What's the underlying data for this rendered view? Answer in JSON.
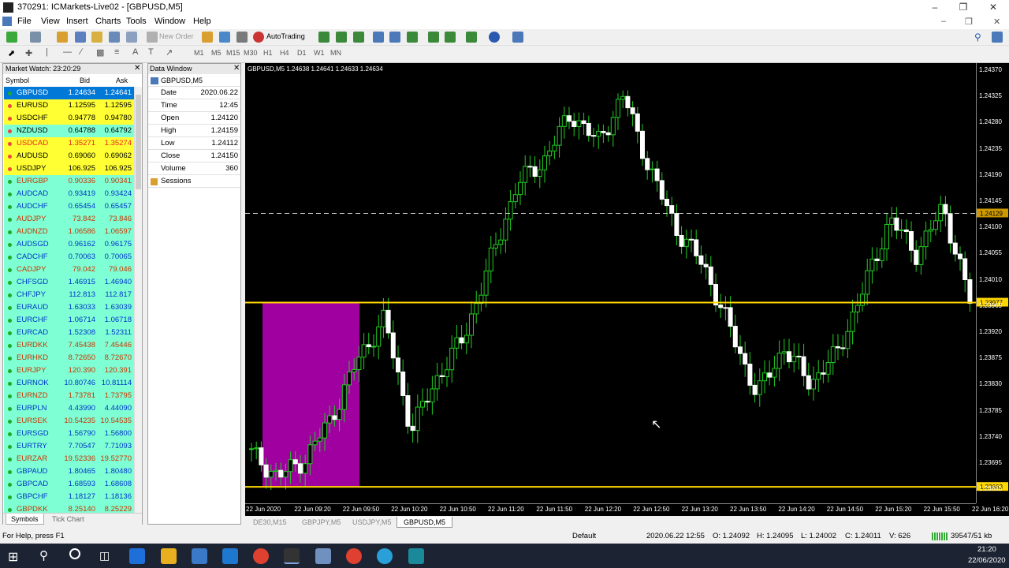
{
  "window": {
    "title": "370291: ICMarkets-Live02 - [GBPUSD,M5]"
  },
  "menu": [
    "File",
    "View",
    "Insert",
    "Charts",
    "Tools",
    "Window",
    "Help"
  ],
  "toolbar": {
    "new_order": "New Order",
    "autotrading": "AutoTrading",
    "timeframes": [
      "M1",
      "M5",
      "M15",
      "M30",
      "H1",
      "H4",
      "D1",
      "W1",
      "MN"
    ]
  },
  "market_watch": {
    "title": "Market Watch: 23:20:29",
    "col_symbol": "Symbol",
    "col_bid": "Bid",
    "col_ask": "Ask",
    "rows": [
      {
        "sym": "GBPUSD",
        "bid": "1.24634",
        "ask": "1.24641",
        "bg": "#0078d7",
        "fg": "#fff",
        "dot": "#22aa22"
      },
      {
        "sym": "EURUSD",
        "bid": "1.12595",
        "ask": "1.12595",
        "bg": "#ffff33",
        "fg": "#000",
        "dot": "#ee4444"
      },
      {
        "sym": "USDCHF",
        "bid": "0.94778",
        "ask": "0.94780",
        "bg": "#ffff33",
        "fg": "#000",
        "dot": "#ee4444"
      },
      {
        "sym": "NZDUSD",
        "bid": "0.64788",
        "ask": "0.64792",
        "bg": "#7fffd4",
        "fg": "#000",
        "dot": "#ee4444"
      },
      {
        "sym": "USDCAD",
        "bid": "1.35271",
        "ask": "1.35274",
        "bg": "#ffff33",
        "fg": "#ee2222",
        "dot": "#ee4444"
      },
      {
        "sym": "AUDUSD",
        "bid": "0.69060",
        "ask": "0.69062",
        "bg": "#ffff33",
        "fg": "#000",
        "dot": "#ee4444"
      },
      {
        "sym": "USDJPY",
        "bid": "106.925",
        "ask": "106.925",
        "bg": "#ffff33",
        "fg": "#000",
        "dot": "#ee4444"
      },
      {
        "sym": "EURGBP",
        "bid": "0.90336",
        "ask": "0.90341",
        "bg": "#7fffd4",
        "fg": "#cc3300",
        "dot": "#22aa22"
      },
      {
        "sym": "AUDCAD",
        "bid": "0.93419",
        "ask": "0.93424",
        "bg": "#7fffd4",
        "fg": "#0033cc",
        "dot": "#22aa22"
      },
      {
        "sym": "AUDCHF",
        "bid": "0.65454",
        "ask": "0.65457",
        "bg": "#7fffd4",
        "fg": "#0033cc",
        "dot": "#22aa22"
      },
      {
        "sym": "AUDJPY",
        "bid": "73.842",
        "ask": "73.846",
        "bg": "#7fffd4",
        "fg": "#cc3300",
        "dot": "#22aa22"
      },
      {
        "sym": "AUDNZD",
        "bid": "1.06586",
        "ask": "1.06597",
        "bg": "#7fffd4",
        "fg": "#cc3300",
        "dot": "#22aa22"
      },
      {
        "sym": "AUDSGD",
        "bid": "0.96162",
        "ask": "0.96175",
        "bg": "#7fffd4",
        "fg": "#0033cc",
        "dot": "#22aa22"
      },
      {
        "sym": "CADCHF",
        "bid": "0.70063",
        "ask": "0.70065",
        "bg": "#7fffd4",
        "fg": "#0033cc",
        "dot": "#22aa22"
      },
      {
        "sym": "CADJPY",
        "bid": "79.042",
        "ask": "79.046",
        "bg": "#7fffd4",
        "fg": "#cc3300",
        "dot": "#22aa22"
      },
      {
        "sym": "CHFSGD",
        "bid": "1.46915",
        "ask": "1.46940",
        "bg": "#7fffd4",
        "fg": "#0033cc",
        "dot": "#22aa22"
      },
      {
        "sym": "CHFJPY",
        "bid": "112.813",
        "ask": "112.817",
        "bg": "#7fffd4",
        "fg": "#0033cc",
        "dot": "#22aa22"
      },
      {
        "sym": "EURAUD",
        "bid": "1.63033",
        "ask": "1.63039",
        "bg": "#7fffd4",
        "fg": "#0033cc",
        "dot": "#22aa22"
      },
      {
        "sym": "EURCHF",
        "bid": "1.06714",
        "ask": "1.06718",
        "bg": "#7fffd4",
        "fg": "#0033cc",
        "dot": "#22aa22"
      },
      {
        "sym": "EURCAD",
        "bid": "1.52308",
        "ask": "1.52311",
        "bg": "#7fffd4",
        "fg": "#0033cc",
        "dot": "#22aa22"
      },
      {
        "sym": "EURDKK",
        "bid": "7.45438",
        "ask": "7.45446",
        "bg": "#7fffd4",
        "fg": "#cc3300",
        "dot": "#22aa22"
      },
      {
        "sym": "EURHKD",
        "bid": "8.72650",
        "ask": "8.72670",
        "bg": "#7fffd4",
        "fg": "#cc3300",
        "dot": "#22aa22"
      },
      {
        "sym": "EURJPY",
        "bid": "120.390",
        "ask": "120.391",
        "bg": "#7fffd4",
        "fg": "#cc3300",
        "dot": "#22aa22"
      },
      {
        "sym": "EURNOK",
        "bid": "10.80746",
        "ask": "10.81114",
        "bg": "#7fffd4",
        "fg": "#0033cc",
        "dot": "#22aa22"
      },
      {
        "sym": "EURNZD",
        "bid": "1.73781",
        "ask": "1.73795",
        "bg": "#7fffd4",
        "fg": "#cc3300",
        "dot": "#22aa22"
      },
      {
        "sym": "EURPLN",
        "bid": "4.43990",
        "ask": "4.44090",
        "bg": "#7fffd4",
        "fg": "#0033cc",
        "dot": "#22aa22"
      },
      {
        "sym": "EURSEK",
        "bid": "10.54235",
        "ask": "10.54535",
        "bg": "#7fffd4",
        "fg": "#cc3300",
        "dot": "#22aa22"
      },
      {
        "sym": "EURSGD",
        "bid": "1.56790",
        "ask": "1.56800",
        "bg": "#7fffd4",
        "fg": "#0033cc",
        "dot": "#22aa22"
      },
      {
        "sym": "EURTRY",
        "bid": "7.70547",
        "ask": "7.71093",
        "bg": "#7fffd4",
        "fg": "#0033cc",
        "dot": "#22aa22"
      },
      {
        "sym": "EURZAR",
        "bid": "19.52336",
        "ask": "19.52770",
        "bg": "#7fffd4",
        "fg": "#cc3300",
        "dot": "#22aa22"
      },
      {
        "sym": "GBPAUD",
        "bid": "1.80465",
        "ask": "1.80480",
        "bg": "#7fffd4",
        "fg": "#0033cc",
        "dot": "#22aa22"
      },
      {
        "sym": "GBPCAD",
        "bid": "1.68593",
        "ask": "1.68608",
        "bg": "#7fffd4",
        "fg": "#0033cc",
        "dot": "#22aa22"
      },
      {
        "sym": "GBPCHF",
        "bid": "1.18127",
        "ask": "1.18136",
        "bg": "#7fffd4",
        "fg": "#0033cc",
        "dot": "#22aa22"
      },
      {
        "sym": "GBPDKK",
        "bid": "8.25140",
        "ask": "8.25229",
        "bg": "#7fffd4",
        "fg": "#cc3300",
        "dot": "#22aa22"
      }
    ],
    "tabs": [
      "Symbols",
      "Tick Chart"
    ]
  },
  "data_window": {
    "title": "Data Window",
    "symbol": "GBPUSD,M5",
    "rows": [
      {
        "k": "Date",
        "v": "2020.06.22"
      },
      {
        "k": "Time",
        "v": "12:45"
      },
      {
        "k": "Open",
        "v": "1.24120"
      },
      {
        "k": "High",
        "v": "1.24159"
      },
      {
        "k": "Low",
        "v": "1.24112"
      },
      {
        "k": "Close",
        "v": "1.24150"
      },
      {
        "k": "Volume",
        "v": "360"
      },
      {
        "k": "Sessions",
        "v": ""
      }
    ]
  },
  "chart": {
    "info": "GBPUSD,M5  1.24638 1.24641 1.24633 1.24634",
    "y_ticks": [
      "1.24370",
      "1.24325",
      "1.24280",
      "1.24235",
      "1.24190",
      "1.24145",
      "1.24100",
      "1.24055",
      "1.24010",
      "1.23965",
      "1.23920",
      "1.23875",
      "1.23830",
      "1.23785",
      "1.23740",
      "1.23695",
      "1.23650"
    ],
    "x_ticks": [
      "22 Jun 2020",
      "22 Jun 09:20",
      "22 Jun 09:50",
      "22 Jun 10:20",
      "22 Jun 10:50",
      "22 Jun 11:20",
      "22 Jun 11:50",
      "22 Jun 12:20",
      "22 Jun 12:50",
      "22 Jun 13:20",
      "22 Jun 13:50",
      "22 Jun 14:20",
      "22 Jun 14:50",
      "22 Jun 15:20",
      "22 Jun 15:50",
      "22 Jun 16:20"
    ],
    "price_labels": {
      "bid": "1.24129",
      "line1": "1.23977",
      "line2": "1.23663"
    },
    "levels": {
      "bid": 1.24129,
      "line1": 1.23977,
      "line2": 1.23663,
      "ymax": 1.24385,
      "ymin": 1.23635
    }
  },
  "chart_tabs": [
    "DE30,M15",
    "GBPJPY,M5",
    "USDJPY,M5",
    "GBPUSD,M5"
  ],
  "status": {
    "help": "For Help, press F1",
    "profile": "Default",
    "datetime": "2020.06.22 12:55",
    "o": "O: 1.24092",
    "h": "H: 1.24095",
    "l": "L: 1.24002",
    "c": "C: 1.24011",
    "v": "V: 626",
    "conn": "39547/51 kb"
  },
  "taskbar": {
    "time": "21:20",
    "date": "22/06/2020"
  }
}
